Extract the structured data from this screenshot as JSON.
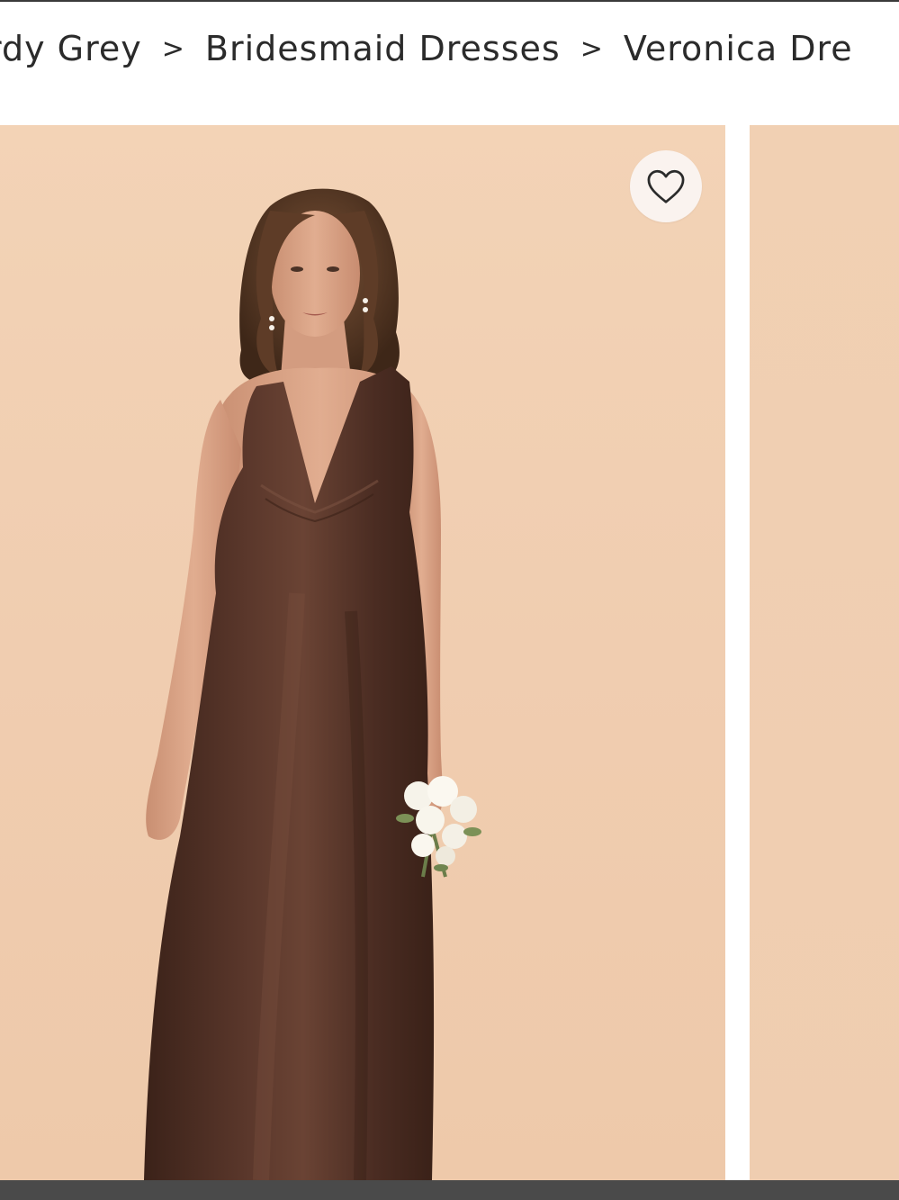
{
  "breadcrumb": {
    "items": [
      {
        "label": "rdy Grey"
      },
      {
        "label": "Bridesmaid Dresses"
      },
      {
        "label": "Veronica Dre"
      }
    ],
    "separator": ">"
  },
  "gallery": {
    "favorite_icon": "heart-outline-icon",
    "background_color": "#f1cfb2",
    "dress_color": "#4e3026"
  }
}
